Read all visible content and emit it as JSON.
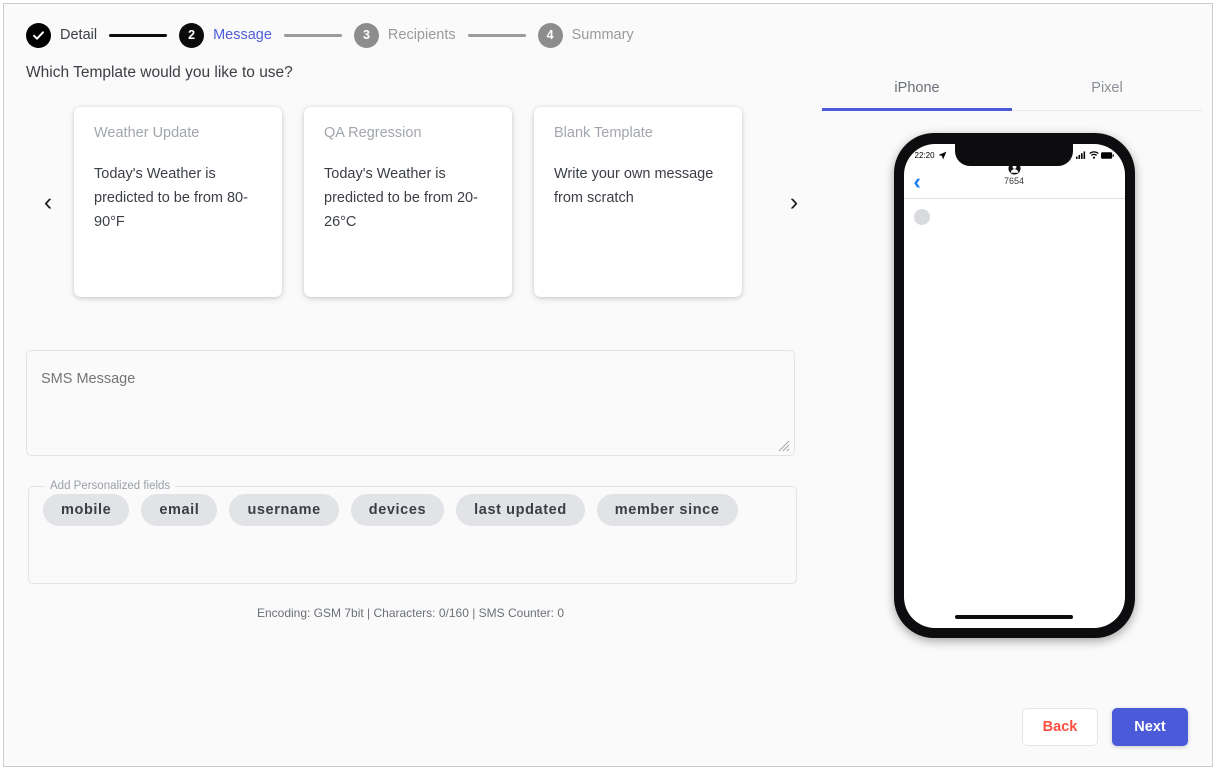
{
  "stepper": {
    "steps": [
      {
        "marker": "check",
        "label": "Detail",
        "state": "done"
      },
      {
        "marker": "2",
        "label": "Message",
        "state": "active"
      },
      {
        "marker": "3",
        "label": "Recipients",
        "state": "todo"
      },
      {
        "marker": "4",
        "label": "Summary",
        "state": "todo"
      }
    ],
    "active_color": "#4f5ddb",
    "done_color": "#000000",
    "todo_color": "#8d8d8d"
  },
  "main": {
    "question": "Which Template would you like to use?",
    "carousel": {
      "prev_icon": "chevron-left-icon",
      "next_icon": "chevron-right-icon",
      "prev_glyph": "‹",
      "next_glyph": "›",
      "cards": [
        {
          "title": "Weather Update",
          "body": "Today's Weather is predicted to be from 80-90°F"
        },
        {
          "title": "QA Regression",
          "body": "Today's Weather is predicted to be from 20-26°C"
        },
        {
          "title": "Blank Template",
          "body": "Write your own message from scratch"
        }
      ]
    },
    "sms": {
      "placeholder": "SMS Message",
      "value": "",
      "resize_handle_icon": "resize-grip-icon"
    },
    "personalized": {
      "legend": "Add Personalized fields",
      "chips": [
        "mobile",
        "email",
        "username",
        "devices",
        "last updated",
        "member since"
      ]
    },
    "encoding_status": "Encoding: GSM 7bit | Characters: 0/160 | SMS Counter: 0"
  },
  "preview": {
    "tabs": [
      {
        "label": "iPhone",
        "selected": true
      },
      {
        "label": "Pixel",
        "selected": false
      }
    ],
    "tab_accent": "#4a5ad8",
    "phone": {
      "status_time": "22:20",
      "location_icon": "location-arrow-icon",
      "signal_icon": "cellular-signal-icon",
      "wifi_icon": "wifi-icon",
      "battery_icon": "battery-full-icon",
      "back_icon": "chevron-left-icon",
      "back_glyph": "‹",
      "contact_avatar_icon": "person-circle-icon",
      "contact_name": "7654",
      "home_indicator_icon": "home-indicator"
    }
  },
  "footer": {
    "back_label": "Back",
    "next_label": "Next",
    "back_color": "#ff4f42",
    "next_bg": "#4a5ad8"
  }
}
